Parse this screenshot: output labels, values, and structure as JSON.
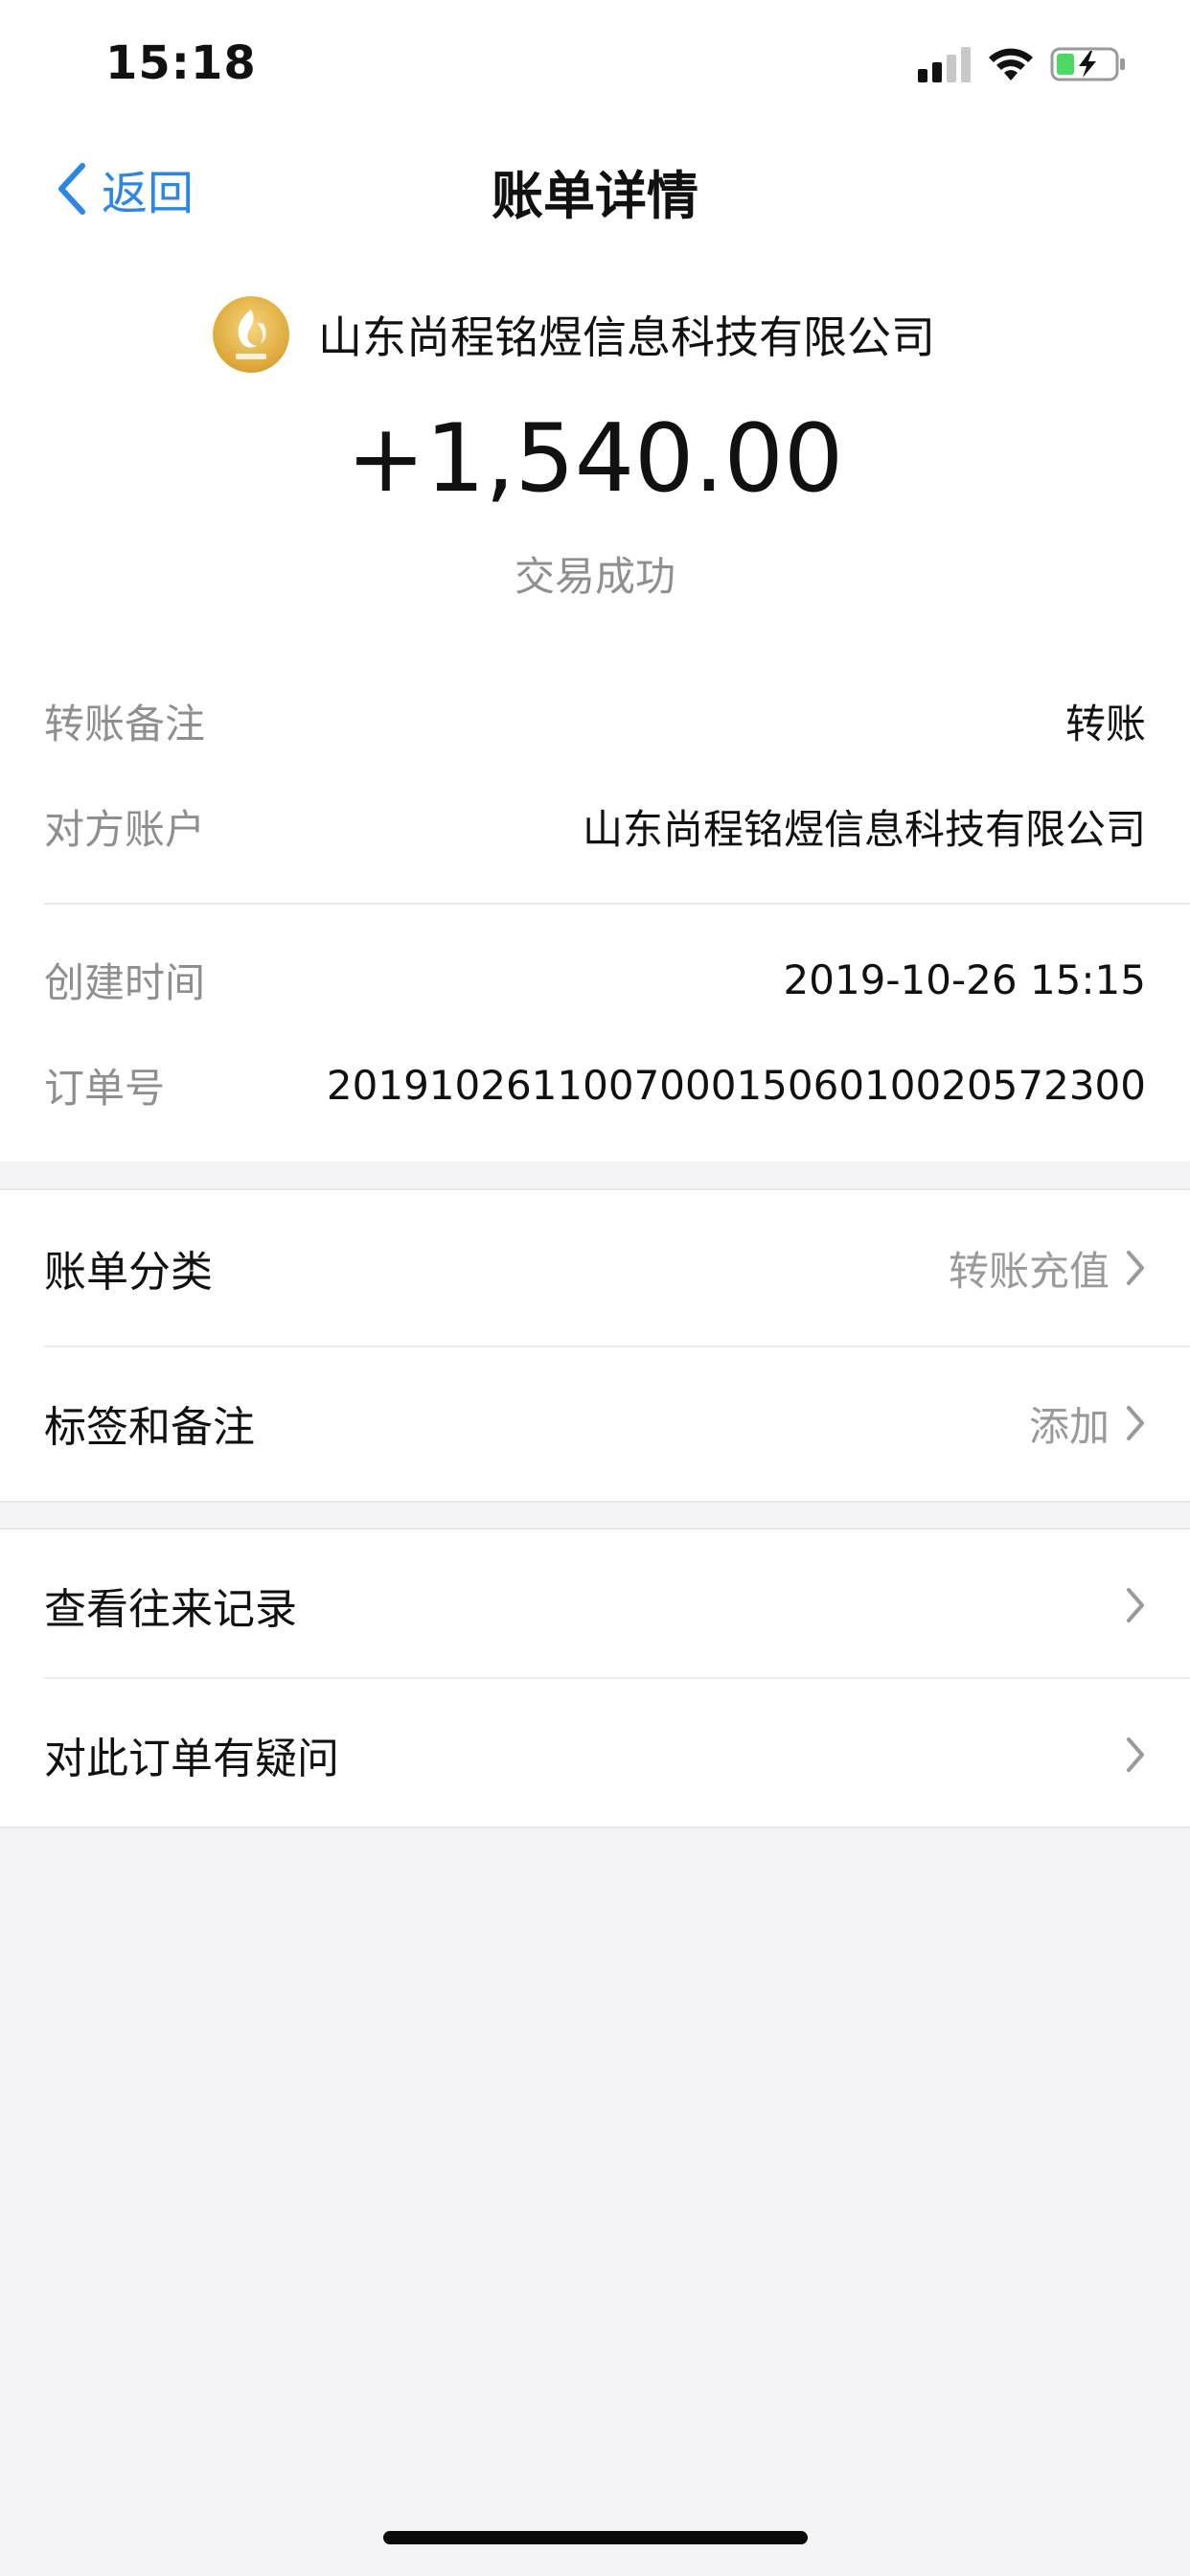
{
  "status_bar": {
    "time": "15:18"
  },
  "nav": {
    "back_label": "返回",
    "title": "账单详情"
  },
  "merchant": {
    "name": "山东尚程铭煜信息科技有限公司",
    "logo_icon": "merchant-logo-icon"
  },
  "transaction": {
    "amount": "+1,540.00",
    "status": "交易成功"
  },
  "details": [
    {
      "label": "转账备注",
      "value": "转账"
    },
    {
      "label": "对方账户",
      "value": "山东尚程铭煜信息科技有限公司"
    },
    {
      "label": "创建时间",
      "value": "2019-10-26 15:15"
    },
    {
      "label": "订单号",
      "value": "2019102611007000150601002057​2300"
    }
  ],
  "group1": [
    {
      "label": "账单分类",
      "value": "转账充值"
    },
    {
      "label": "标签和备注",
      "value": "添加"
    }
  ],
  "group2": [
    {
      "label": "查看往来记录"
    },
    {
      "label": "对此订单有疑问"
    }
  ],
  "colors": {
    "accent": "#2b86e6",
    "muted": "#8f8f8f",
    "background": "#f4f4f6"
  }
}
